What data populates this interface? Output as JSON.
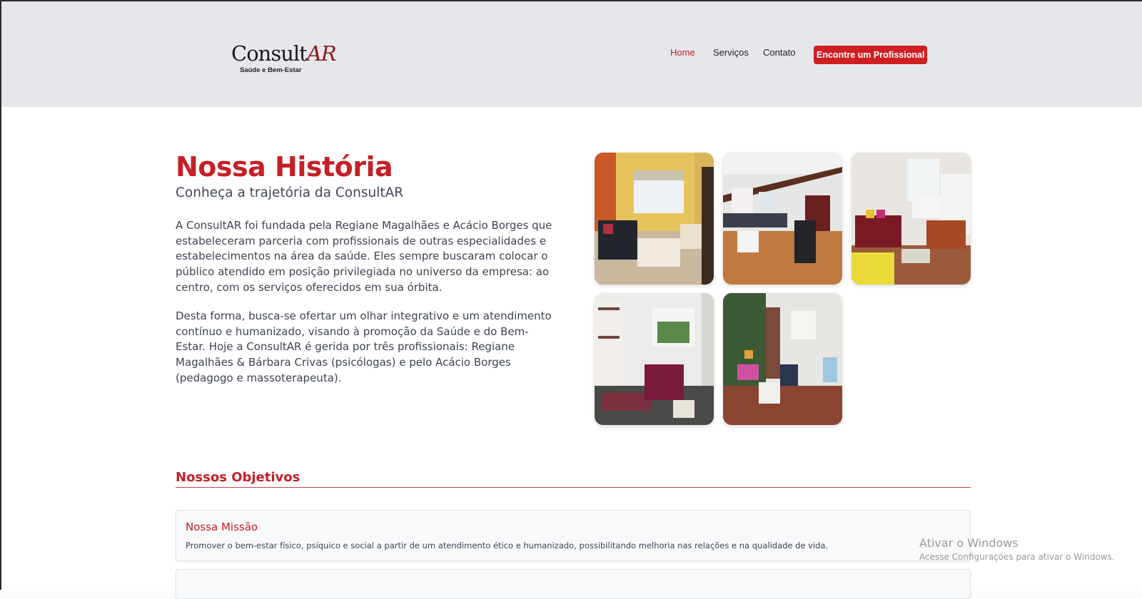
{
  "header": {
    "logo_main": "Consult",
    "logo_accent": "AR",
    "logo_sub": "Saúde e Bem-Estar",
    "nav": [
      {
        "label": "Home",
        "active": true
      },
      {
        "label": "Serviços",
        "active": false
      },
      {
        "label": "Contato",
        "active": false
      }
    ],
    "cta_label": "Encontre um Profissional"
  },
  "history": {
    "title": "Nossa História",
    "subtitle": "Conheça a trajetória da ConsultAR",
    "paragraph1": "A ConsultAR foi fundada pela Regiane Magalhães e Acácio Borges que estabeleceram parceria com profissionais de outras especialidades e estabelecimentos na área da saúde. Eles sempre buscaram colocar o público atendido em posição privilegiada no universo da empresa: ao centro, com os serviços oferecidos em sua órbita.",
    "paragraph2": "Desta forma, busca-se ofertar um olhar integrativo e um atendimento contínuo e humanizado, visando à promoção da Saúde e do Bem-Estar. Hoje a ConsultAR é gerida por três profissionais: Regiane Magalhães & Bárbara Crivas (psicólogas) e pelo Acácio Borges (pedagogo e massoterapeuta)."
  },
  "gallery": {
    "images": [
      {
        "name": "office-living-room-photo"
      },
      {
        "name": "therapy-room-photo"
      },
      {
        "name": "kids-room-photo"
      },
      {
        "name": "consult-room-photo"
      },
      {
        "name": "hallway-photo"
      }
    ]
  },
  "objectives": {
    "title": "Nossos Objetivos",
    "mission_title": "Nossa Missão",
    "mission_text": "Promover o bem-estar físico, psíquico e social a partir de um atendimento ético e humanizado, possibilitando melhoria nas relações e na qualidade de vida."
  },
  "watermark": {
    "title": "Ativar o Windows",
    "subtitle": "Acesse Configurações para ativar o Windows."
  },
  "colors": {
    "accent": "#c42026",
    "header_bg": "#e5e7eb",
    "cta_bg": "#cf1f23"
  }
}
